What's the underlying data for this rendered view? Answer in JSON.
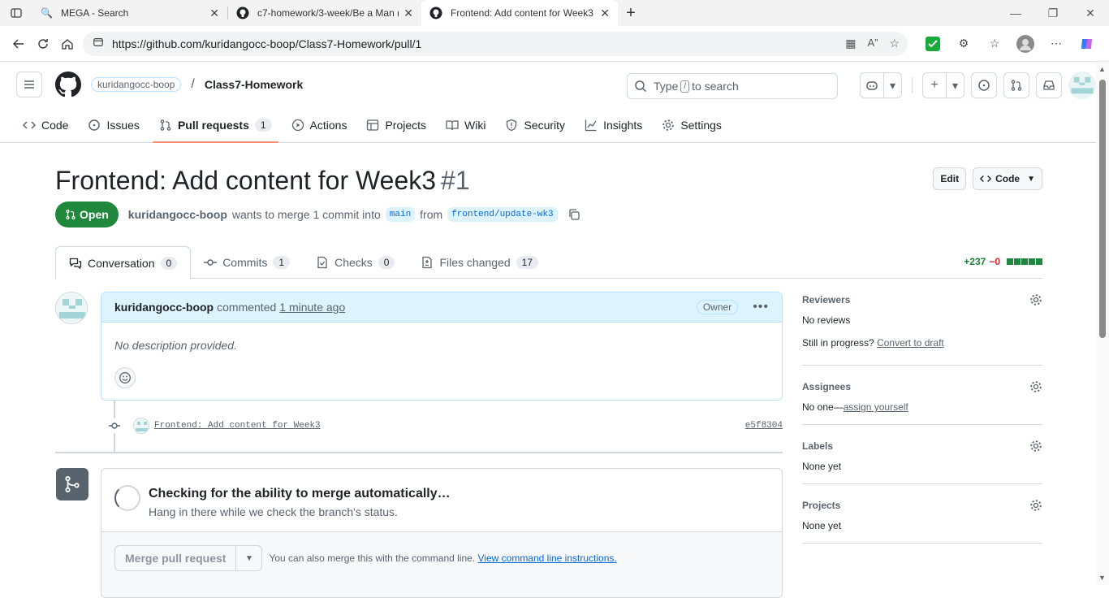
{
  "browser": {
    "tabs": [
      {
        "title": "MEGA - Search",
        "active": false
      },
      {
        "title": "c7-homework/3-week/Be a Man (",
        "active": false
      },
      {
        "title": "Frontend: Add content for Week3",
        "active": true
      }
    ],
    "url": "https://github.com/kuridangocc-boop/Class7-Homework/pull/1"
  },
  "header": {
    "owner": "kuridangocc-boop",
    "separator": "/",
    "repo": "Class7-Homework",
    "search_prefix": "Type",
    "search_key": "/",
    "search_suffix": "to search"
  },
  "repo_nav": [
    {
      "label": "Code"
    },
    {
      "label": "Issues"
    },
    {
      "label": "Pull requests",
      "count": "1"
    },
    {
      "label": "Actions"
    },
    {
      "label": "Projects"
    },
    {
      "label": "Wiki"
    },
    {
      "label": "Security"
    },
    {
      "label": "Insights"
    },
    {
      "label": "Settings"
    }
  ],
  "pr": {
    "title": "Frontend: Add content for Week3",
    "number": "#1",
    "edit_label": "Edit",
    "code_label": "Code",
    "state": "Open",
    "author": "kuridangocc-boop",
    "merge_text": "wants to merge 1 commit into",
    "base_branch": "main",
    "from_text": "from",
    "head_branch": "frontend/update-wk3"
  },
  "pr_tabs": [
    {
      "label": "Conversation",
      "count": "0"
    },
    {
      "label": "Commits",
      "count": "1"
    },
    {
      "label": "Checks",
      "count": "0"
    },
    {
      "label": "Files changed",
      "count": "17"
    }
  ],
  "diffstat": {
    "additions": "+237",
    "deletions": "−0"
  },
  "comment": {
    "author": "kuridangocc-boop",
    "action": "commented",
    "time": "1 minute ago",
    "role": "Owner",
    "body": "No description provided."
  },
  "commit": {
    "message": "Frontend: Add content for Week3",
    "sha": "e5f8304"
  },
  "merge": {
    "title": "Checking for the ability to merge automatically…",
    "subtitle": "Hang in there while we check the branch's status.",
    "button": "Merge pull request",
    "hint": "You can also merge this with the command line.",
    "link": "View command line instructions."
  },
  "sidebar": {
    "reviewers": {
      "heading": "Reviewers",
      "value": "No reviews",
      "progress": "Still in progress?",
      "convert": "Convert to draft"
    },
    "assignees": {
      "heading": "Assignees",
      "value": "No one—",
      "link": "assign yourself"
    },
    "labels": {
      "heading": "Labels",
      "value": "None yet"
    },
    "projects": {
      "heading": "Projects",
      "value": "None yet"
    }
  },
  "colors": {
    "accent": "#0969da",
    "open": "#1f883d",
    "tab_underline": "#fd8c73"
  }
}
